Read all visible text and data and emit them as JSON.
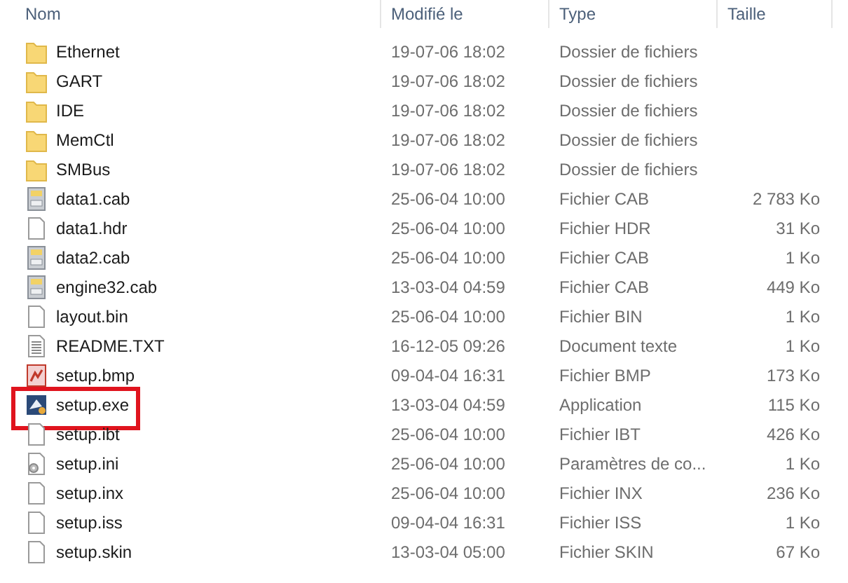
{
  "columns": [
    {
      "label": "Nom"
    },
    {
      "label": "Modifié le"
    },
    {
      "label": "Type"
    },
    {
      "label": "Taille"
    }
  ],
  "rows": [
    {
      "kind": "folder",
      "name": "Ethernet",
      "modified": "19-07-06 18:02",
      "type": "Dossier de fichiers",
      "highlighted": false
    },
    {
      "kind": "folder",
      "name": "GART",
      "modified": "19-07-06 18:02",
      "type": "Dossier de fichiers",
      "highlighted": false
    },
    {
      "kind": "folder",
      "name": "IDE",
      "modified": "19-07-06 18:02",
      "type": "Dossier de fichiers",
      "highlighted": false
    },
    {
      "kind": "folder",
      "name": "MemCtl",
      "modified": "19-07-06 18:02",
      "type": "Dossier de fichiers",
      "highlighted": false
    },
    {
      "kind": "folder",
      "name": "SMBus",
      "modified": "19-07-06 18:02",
      "type": "Dossier de fichiers",
      "highlighted": false
    },
    {
      "kind": "cab",
      "name": "data1.cab",
      "modified": "25-06-04 10:00",
      "type": "Fichier CAB",
      "size": "2 783 Ko",
      "highlighted": false
    },
    {
      "kind": "file",
      "name": "data1.hdr",
      "modified": "25-06-04 10:00",
      "type": "Fichier HDR",
      "size": "31 Ko",
      "highlighted": false
    },
    {
      "kind": "cab",
      "name": "data2.cab",
      "modified": "25-06-04 10:00",
      "type": "Fichier CAB",
      "size": "1 Ko",
      "highlighted": false
    },
    {
      "kind": "cab",
      "name": "engine32.cab",
      "modified": "13-03-04 04:59",
      "type": "Fichier CAB",
      "size": "449 Ko",
      "highlighted": false
    },
    {
      "kind": "file",
      "name": "layout.bin",
      "modified": "25-06-04 10:00",
      "type": "Fichier BIN",
      "size": "1 Ko",
      "highlighted": false
    },
    {
      "kind": "text",
      "name": "README.TXT",
      "modified": "16-12-05 09:26",
      "type": "Document texte",
      "size": "1 Ko",
      "highlighted": false
    },
    {
      "kind": "image",
      "name": "setup.bmp",
      "modified": "09-04-04 16:31",
      "type": "Fichier BMP",
      "size": "173 Ko",
      "highlighted": false
    },
    {
      "kind": "app",
      "name": "setup.exe",
      "modified": "13-03-04 04:59",
      "type": "Application",
      "size": "115 Ko",
      "highlighted": true
    },
    {
      "kind": "file",
      "name": "setup.ibt",
      "modified": "25-06-04 10:00",
      "type": "Fichier IBT",
      "size": "426 Ko",
      "highlighted": false
    },
    {
      "kind": "settings",
      "name": "setup.ini",
      "modified": "25-06-04 10:00",
      "type": "Paramètres de co...",
      "size": "1 Ko",
      "highlighted": false
    },
    {
      "kind": "file",
      "name": "setup.inx",
      "modified": "25-06-04 10:00",
      "type": "Fichier INX",
      "size": "236 Ko",
      "highlighted": false
    },
    {
      "kind": "file",
      "name": "setup.iss",
      "modified": "09-04-04 16:31",
      "type": "Fichier ISS",
      "size": "1 Ko",
      "highlighted": false
    },
    {
      "kind": "file",
      "name": "setup.skin",
      "modified": "13-03-04 05:00",
      "type": "Fichier SKIN",
      "size": "67 Ko",
      "highlighted": false
    }
  ]
}
